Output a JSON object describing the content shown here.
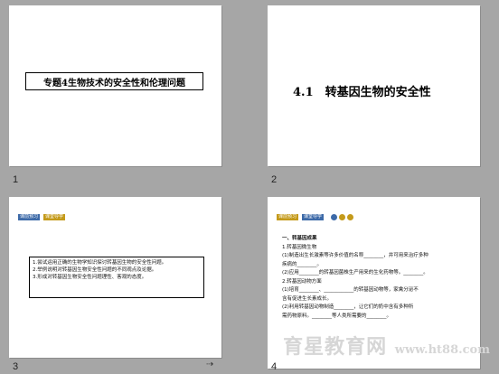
{
  "slides": [
    {
      "number": "1",
      "title": "专题4生物技术的安全性和伦理问题"
    },
    {
      "number": "2",
      "title": "4.1　转基因生物的安全性"
    },
    {
      "number": "3",
      "tags": [
        "课前预习",
        "课堂导学"
      ],
      "objectives": [
        "1.尝试运用正确的生物学知识探讨转基因生物的安全性问题。",
        "2.举例说明对转基因生物安全性问题的不同观点及论据。",
        "3.形成对转基因生物安全性问题理性、客观的态度。"
      ]
    },
    {
      "number": "4",
      "tags": [
        "课前预习",
        "课堂导学"
      ],
      "lines": [
        "一、转基因成果",
        "1.转基因微生物",
        "(1)制造出生长激素等许多价值的名称________，并可用来治疗多种",
        "疾病的________。",
        "(2)应用________的转基因菌株生产用来的生化药物等。________。",
        "2.转基因动物方面",
        "(1)培育________、____________的转基因动物等，家禽分泌不",
        "含有促进生长素成长。",
        "(2)利用转基因动物制造________，让它们的奶中含有多种所",
        "需药物原料。________等人类所需要的________。"
      ]
    }
  ],
  "watermark": {
    "text": "育星教育网",
    "url": "www.ht88.com"
  },
  "colors": {
    "tag_blue": "#3d6aa8",
    "tag_gold": "#c49a1a",
    "background": "#a6a6a6"
  }
}
